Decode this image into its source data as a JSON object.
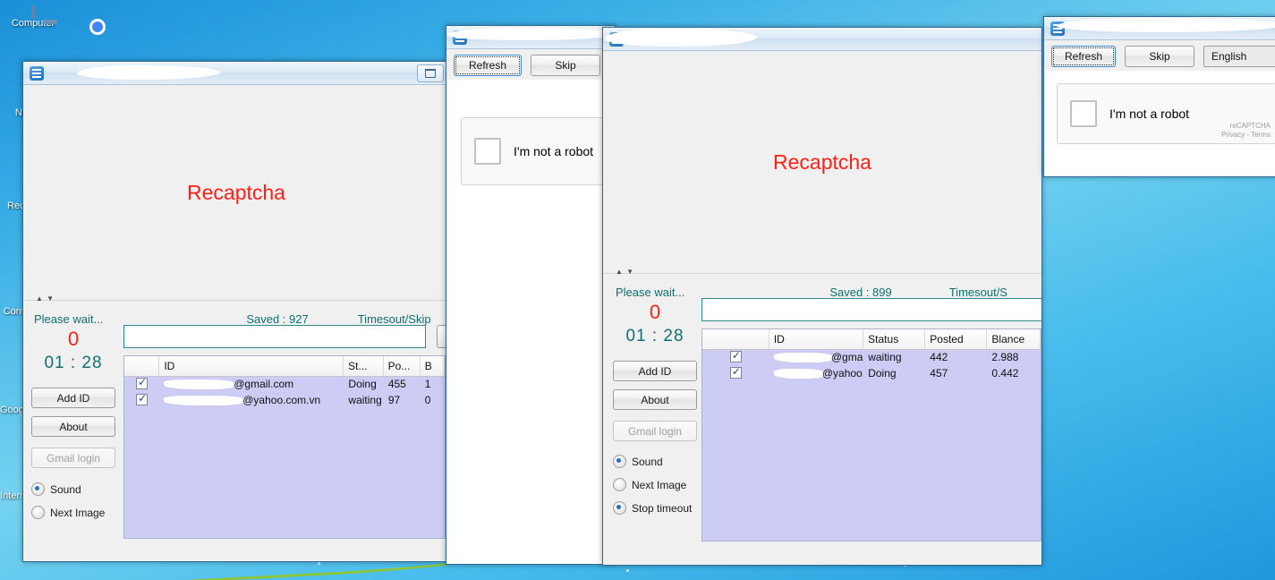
{
  "desktop": {
    "icons": [
      {
        "name": "computer",
        "label": "Computer"
      },
      {
        "name": "network",
        "label": "Network"
      },
      {
        "name": "recycle-bin",
        "label": "Recycle Bin"
      },
      {
        "name": "control-panel",
        "label": "Control Panel"
      },
      {
        "name": "google-chrome",
        "label": "Google Chrome"
      },
      {
        "name": "internet-download-manager",
        "label": "Internet Download Manager"
      }
    ]
  },
  "window_main": {
    "title": "",
    "icon": "app-icon",
    "minimize_label": "Minimize",
    "captcha_text": "Recaptcha",
    "status": {
      "wait_label": "Please wait...",
      "saved_label": "Saved : 927",
      "timesout_label": "Timesout/Skip"
    },
    "counter": "0",
    "timer": "01 : 28",
    "buttons": {
      "add_id": "Add ID",
      "about": "About",
      "gmail_login": "Gmail login"
    },
    "radios": [
      {
        "label": "Sound",
        "selected": true
      },
      {
        "label": "Next Image",
        "selected": false
      }
    ],
    "grid": {
      "columns": [
        "",
        "ID",
        "St...",
        "Po...",
        "B"
      ],
      "rows": [
        {
          "checked": true,
          "id": "@gmail.com",
          "status": "Doing",
          "posted": "455",
          "blance": "1"
        },
        {
          "checked": true,
          "id": "@yahoo.com.vn",
          "status": "waiting",
          "posted": "97",
          "blance": "0"
        }
      ]
    }
  },
  "window_captcha_left": {
    "title": "",
    "toolbar": {
      "refresh": "Refresh",
      "skip": "Skip"
    },
    "recaptcha": {
      "label": "I'm not a robot"
    }
  },
  "window_second": {
    "title": "",
    "captcha_text": "Recaptcha",
    "status": {
      "wait_label": "Please wait...",
      "saved_label": "Saved : 899",
      "timesout_label": "Timesout/S"
    },
    "counter": "0",
    "timer": "01 : 28",
    "buttons": {
      "add_id": "Add ID",
      "about": "About",
      "gmail_login": "Gmail login"
    },
    "radios": [
      {
        "label": "Sound",
        "selected": true
      },
      {
        "label": "Next Image",
        "selected": false
      },
      {
        "label": "Stop timeout",
        "selected": true
      }
    ],
    "grid": {
      "columns": [
        "",
        "ID",
        "Status",
        "Posted",
        "Blance"
      ],
      "rows": [
        {
          "checked": true,
          "id": "@gmai...",
          "status": "waiting",
          "posted": "442",
          "blance": "2.988"
        },
        {
          "checked": true,
          "id": "@yahoo...",
          "status": "Doing",
          "posted": "457",
          "blance": "0.442"
        }
      ]
    }
  },
  "window_captcha_right": {
    "title": "",
    "toolbar": {
      "refresh": "Refresh",
      "skip": "Skip",
      "language": "English"
    },
    "recaptcha": {
      "label": "I'm not a robot",
      "brand_line1": "reCAPTCHA",
      "brand_line2": "Privacy - Terms"
    }
  },
  "colors": {
    "accent_teal": "#0f7070",
    "alert_red": "#ff2018",
    "grid_selection": "#ccccf5",
    "window_border": "#2f6a95"
  }
}
